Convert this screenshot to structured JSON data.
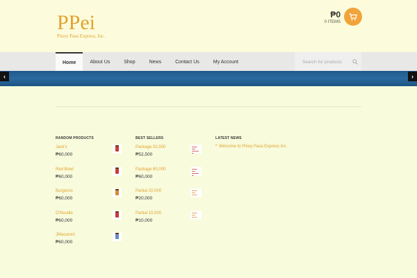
{
  "logo": {
    "main": "PPei",
    "sub": "Pinoy Pasa Express, Inc."
  },
  "cart": {
    "amount": "₱0",
    "items": "0 ITEMS",
    "icon": "cart-icon"
  },
  "nav": {
    "items": [
      "Home",
      "About Us",
      "Shop",
      "News",
      "Contact Us",
      "My Account"
    ],
    "active": "Home"
  },
  "search": {
    "placeholder": "Search for products"
  },
  "slider": {
    "prev": "‹",
    "next": "›"
  },
  "widgets": {
    "random": {
      "title": "RANDOM PRODUCTS",
      "items": [
        {
          "name": "Jack's",
          "price": "₱60,000"
        },
        {
          "name": "Red Bowl",
          "price": "₱60,000"
        },
        {
          "name": "Burgeroo",
          "price": "₱60,000"
        },
        {
          "name": "O'Noodle",
          "price": "₱60,000"
        },
        {
          "name": "JMacaroni",
          "price": "₱60,000"
        }
      ]
    },
    "best": {
      "title": "BEST SELLERS",
      "items": [
        {
          "name": "Package 52,500",
          "price": "₱52,500"
        },
        {
          "name": "Package 60,000",
          "price": "₱60,000"
        },
        {
          "name": "Partial 20,000",
          "price": "₱20,000"
        },
        {
          "name": "Partial 10,000",
          "price": "₱10,000"
        }
      ]
    },
    "news": {
      "title": "LATEST NEWS",
      "items": [
        "Welcome to Pinoy Pasa Express Inc."
      ]
    }
  },
  "colors": {
    "accent": "#e1a32f",
    "background": "#f8fbdc",
    "banner": "#1f5b8c",
    "cart": "#f0a43b"
  }
}
